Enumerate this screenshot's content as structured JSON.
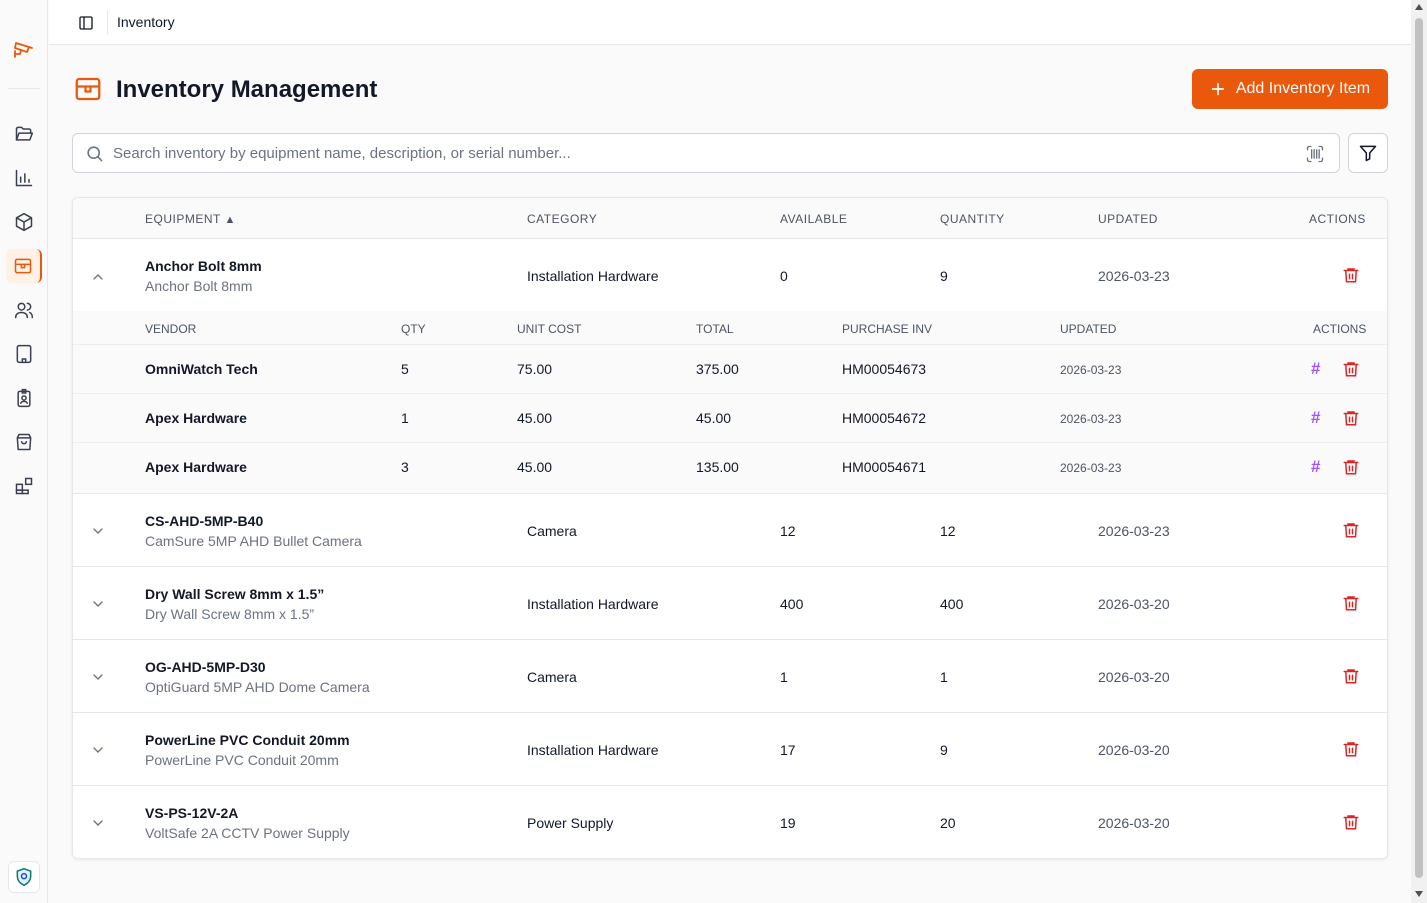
{
  "topbar": {
    "title": "Inventory"
  },
  "page": {
    "title": "Inventory Management",
    "add_button": "Add Inventory Item"
  },
  "search": {
    "placeholder": "Search inventory by equipment name, description, or serial number..."
  },
  "columns": {
    "equipment": "EQUIPMENT",
    "sort_indicator": "▲",
    "category": "CATEGORY",
    "available": "AVAILABLE",
    "quantity": "QUANTITY",
    "updated": "UPDATED",
    "actions": "ACTIONS"
  },
  "sub_columns": {
    "vendor": "VENDOR",
    "qty": "QTY",
    "unit_cost": "UNIT COST",
    "total": "TOTAL",
    "purchase_inv": "PURCHASE INV",
    "updated": "UPDATED",
    "actions": "ACTIONS"
  },
  "hash_glyph": "#",
  "items": [
    {
      "name": "Anchor Bolt 8mm",
      "description": "Anchor Bolt 8mm",
      "category": "Installation Hardware",
      "available": "0",
      "quantity": "9",
      "updated": "2026-03-23",
      "expanded": true
    },
    {
      "name": "CS-AHD-5MP-B40",
      "description": "CamSure 5MP AHD Bullet Camera",
      "category": "Camera",
      "available": "12",
      "quantity": "12",
      "updated": "2026-03-23",
      "expanded": false
    },
    {
      "name": "Dry Wall Screw 8mm x 1.5”",
      "description": "Dry Wall Screw 8mm x 1.5”",
      "category": "Installation Hardware",
      "available": "400",
      "quantity": "400",
      "updated": "2026-03-20",
      "expanded": false
    },
    {
      "name": "OG-AHD-5MP-D30",
      "description": "OptiGuard 5MP AHD Dome Camera",
      "category": "Camera",
      "available": "1",
      "quantity": "1",
      "updated": "2026-03-20",
      "expanded": false
    },
    {
      "name": "PowerLine PVC Conduit 20mm",
      "description": "PowerLine PVC Conduit 20mm",
      "category": "Installation Hardware",
      "available": "17",
      "quantity": "9",
      "updated": "2026-03-20",
      "expanded": false
    },
    {
      "name": "VS-PS-12V-2A",
      "description": "VoltSafe 2A CCTV Power Supply",
      "category": "Power Supply",
      "available": "19",
      "quantity": "20",
      "updated": "2026-03-20",
      "expanded": false
    }
  ],
  "purchases": [
    {
      "vendor": "OmniWatch Tech",
      "qty": "5",
      "unit_cost": "75.00",
      "total": "375.00",
      "purchase_inv": "HM00054673",
      "updated": "2026-03-23"
    },
    {
      "vendor": "Apex Hardware",
      "qty": "1",
      "unit_cost": "45.00",
      "total": "45.00",
      "purchase_inv": "HM00054672",
      "updated": "2026-03-23"
    },
    {
      "vendor": "Apex Hardware",
      "qty": "3",
      "unit_cost": "45.00",
      "total": "135.00",
      "purchase_inv": "HM00054671",
      "updated": "2026-03-23"
    }
  ],
  "colors": {
    "accent": "#ea580c",
    "danger": "#dc2626",
    "hash": "#a855f7"
  },
  "icons": {
    "sidebar": [
      "folder-open-icon",
      "bar-chart-icon",
      "package-icon",
      "store-icon",
      "users-icon",
      "building-icon",
      "id-badge-icon",
      "shopping-bag-icon",
      "blocks-icon"
    ],
    "logo": "cctv-camera-icon",
    "bottom": "shield-icon"
  }
}
